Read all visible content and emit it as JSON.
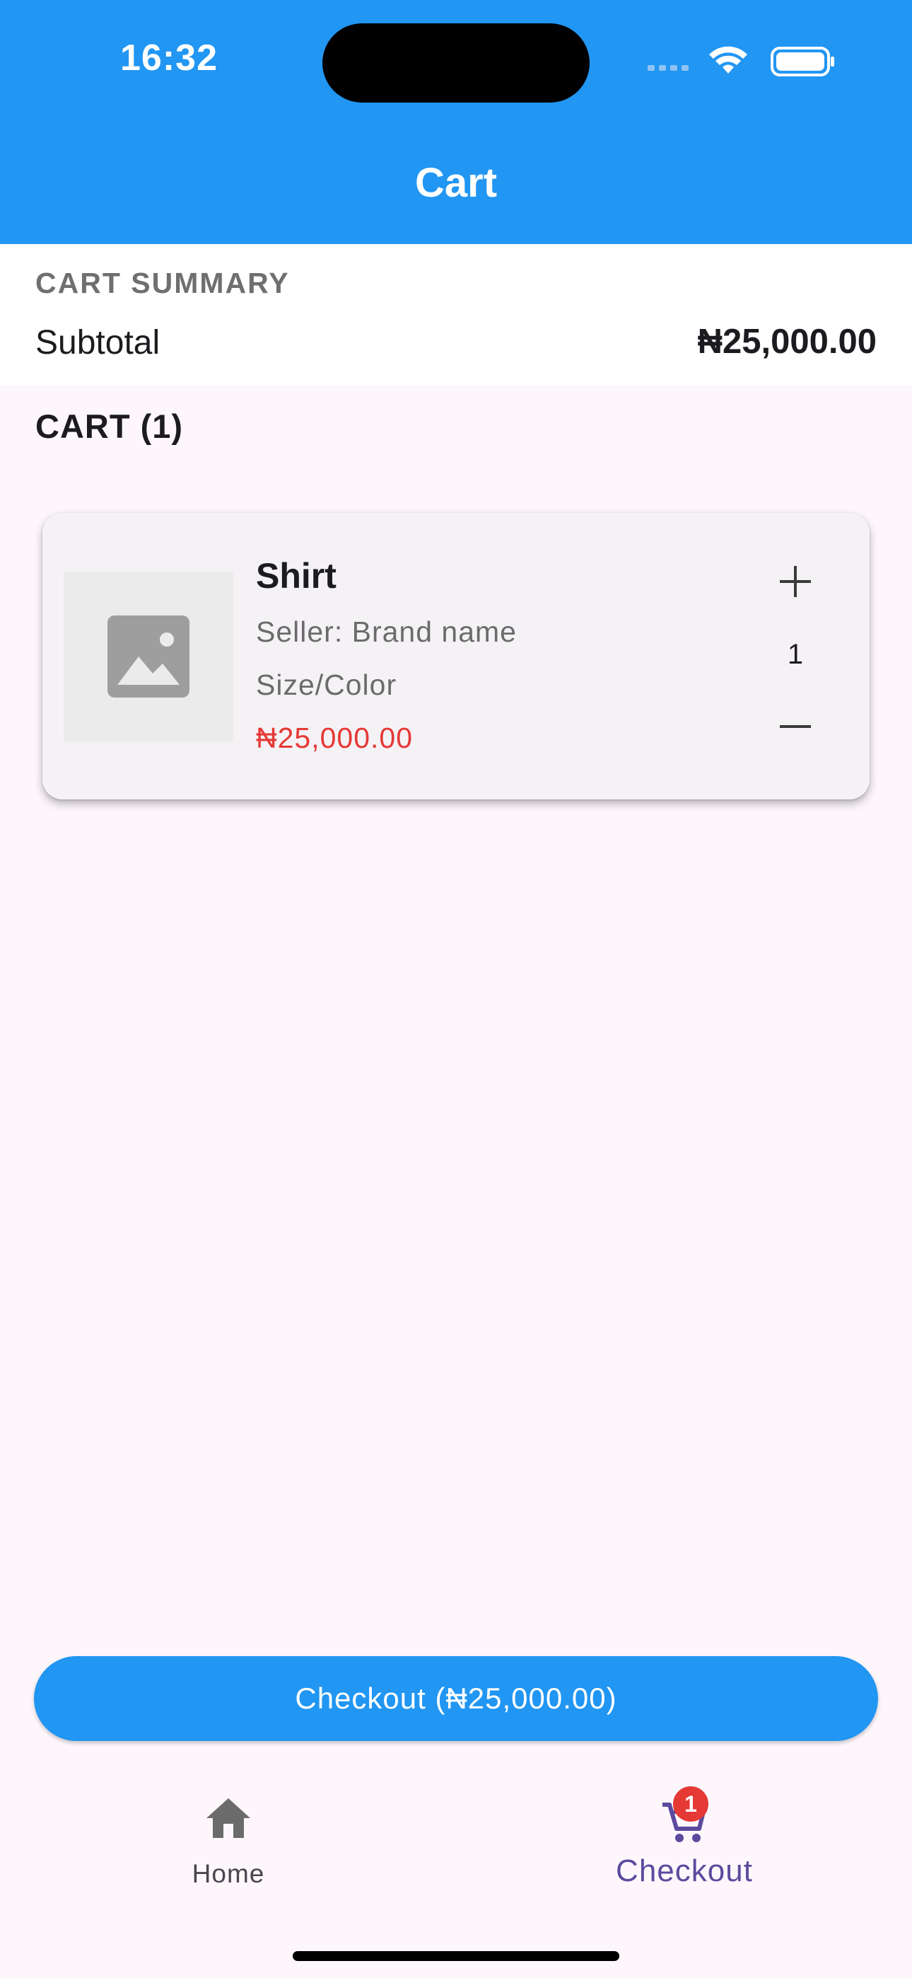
{
  "status_bar": {
    "time": "16:32"
  },
  "app_bar": {
    "title": "Cart"
  },
  "summary": {
    "heading": "CART SUMMARY",
    "subtotal_label": "Subtotal",
    "subtotal_value": "₦25,000.00"
  },
  "cart": {
    "heading": "CART (1)",
    "items": [
      {
        "name": "Shirt",
        "seller": "Seller: Brand name",
        "variant": "Size/Color",
        "price": "₦25,000.00",
        "quantity": "1",
        "image_icon": "image-placeholder-icon"
      }
    ]
  },
  "checkout_button": {
    "label": "Checkout (₦25,000.00)"
  },
  "bottom_nav": {
    "items": [
      {
        "label": "Home",
        "icon": "home-icon",
        "active": false
      },
      {
        "label": "Checkout",
        "icon": "cart-icon",
        "active": true,
        "badge": "1"
      }
    ]
  },
  "colors": {
    "primary": "#2196f3",
    "background": "#fdf7fc",
    "price_red": "#e53935",
    "nav_active": "#5b4a9e"
  }
}
